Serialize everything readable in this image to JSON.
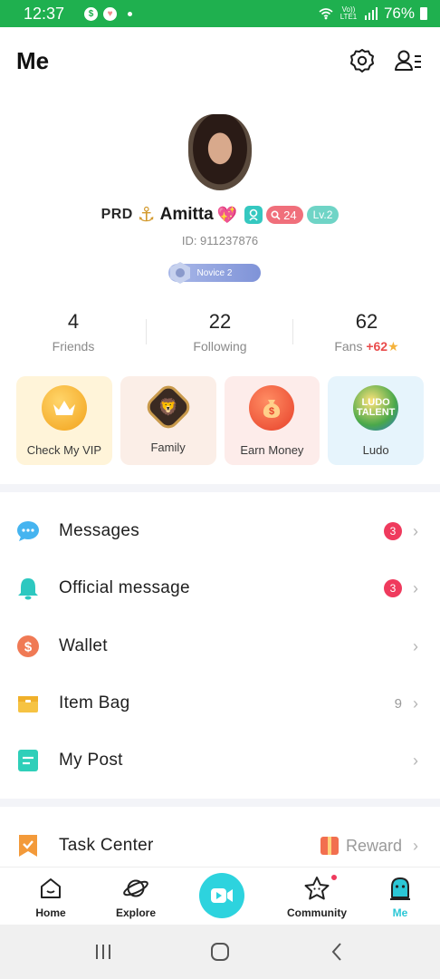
{
  "status_bar": {
    "time": "12:37",
    "network": "Vo)) LTE1",
    "battery": "76%"
  },
  "header": {
    "title": "Me",
    "settings_icon": "gear-icon",
    "profile_menu_icon": "user-list-icon"
  },
  "profile": {
    "name_prefix": "PRD",
    "name": "Amitta",
    "follow_count": "24",
    "level": "Lv.2",
    "user_id": "ID: 911237876",
    "rank": "Novice 2"
  },
  "stats": [
    {
      "value": "4",
      "label": "Friends"
    },
    {
      "value": "22",
      "label": "Following"
    },
    {
      "value": "62",
      "label": "Fans",
      "extra": "+62"
    }
  ],
  "cards": [
    {
      "label": "Check My VIP",
      "icon": "crown-icon"
    },
    {
      "label": "Family",
      "icon": "lion-icon"
    },
    {
      "label": "Earn Money",
      "icon": "money-bag-icon"
    },
    {
      "label": "Ludo",
      "icon": "ludo-icon",
      "icon_text": "LUDO TALENT"
    }
  ],
  "menu": [
    {
      "label": "Messages",
      "badge": "3"
    },
    {
      "label": "Official message",
      "badge": "3"
    },
    {
      "label": "Wallet"
    },
    {
      "label": "Item Bag",
      "count": "9"
    },
    {
      "label": "My Post"
    }
  ],
  "task_center": {
    "label": "Task Center",
    "action": "Reward"
  },
  "bottom_nav": [
    {
      "label": "Home"
    },
    {
      "label": "Explore"
    },
    {
      "label": "Community"
    },
    {
      "label": "Me"
    }
  ],
  "colors": {
    "status_bar": "#1fb04f",
    "accent": "#2dd3de",
    "badge": "#ef3a5d",
    "fans_plus": "#e94b4b"
  }
}
